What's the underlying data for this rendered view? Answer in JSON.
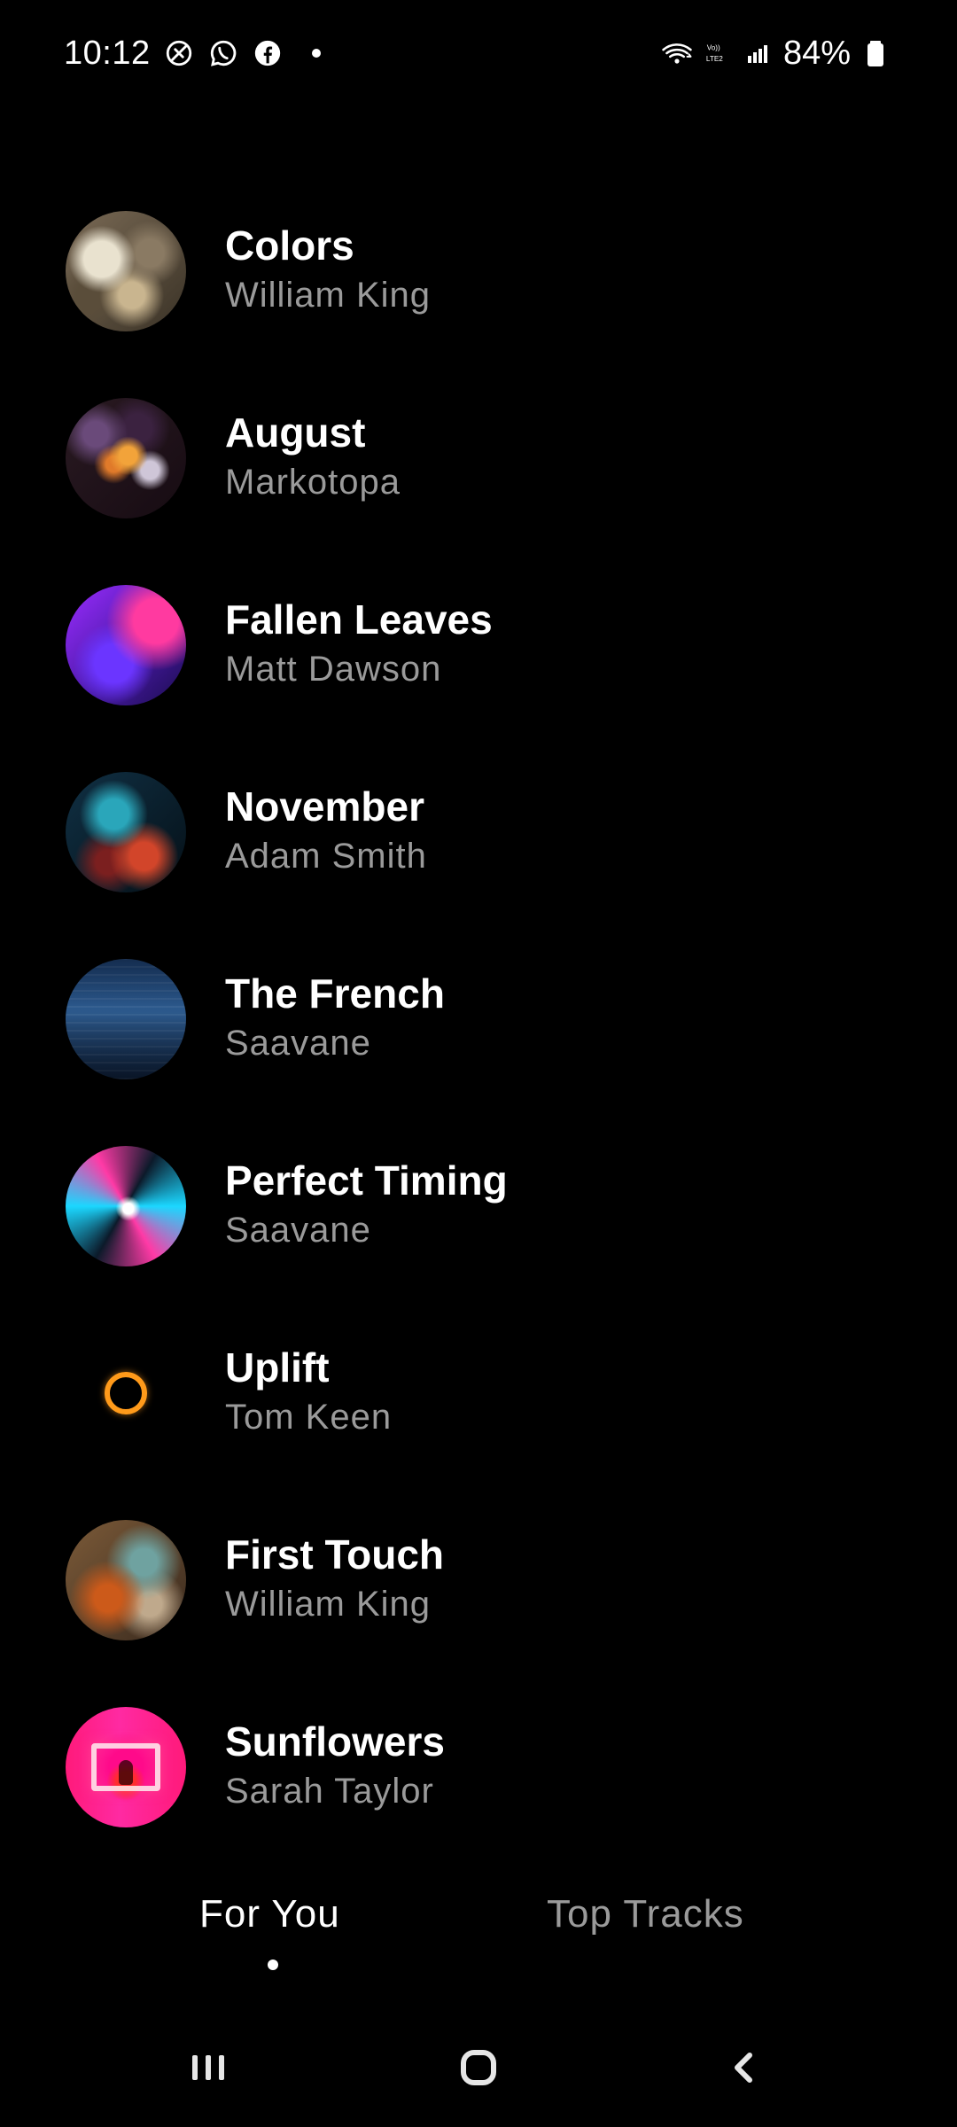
{
  "status_bar": {
    "time": "10:12",
    "battery": "84%",
    "left_icons": [
      "blocked-icon",
      "whatsapp-icon",
      "facebook-icon",
      "dot-icon"
    ],
    "right_icons": [
      "wifi-icon",
      "volte-lte2-icon",
      "signal-icon",
      "battery-icon"
    ]
  },
  "tracks": [
    {
      "title": "Colors",
      "artist": "William King"
    },
    {
      "title": "August",
      "artist": "Markotopa"
    },
    {
      "title": "Fallen Leaves",
      "artist": "Matt Dawson"
    },
    {
      "title": "November",
      "artist": "Adam Smith"
    },
    {
      "title": "The French",
      "artist": "Saavane"
    },
    {
      "title": "Perfect Timing",
      "artist": "Saavane"
    },
    {
      "title": "Uplift",
      "artist": "Tom Keen"
    },
    {
      "title": "First Touch",
      "artist": "William King"
    },
    {
      "title": "Sunflowers",
      "artist": "Sarah Taylor"
    }
  ],
  "tabs": [
    {
      "label": "For You",
      "active": true
    },
    {
      "label": "Top Tracks",
      "active": false
    }
  ],
  "system_nav": {
    "buttons": [
      "recents-icon",
      "home-icon",
      "back-icon"
    ]
  },
  "colors": {
    "background": "#000000",
    "title": "#ffffff",
    "subtitle": "#9a9a9a"
  }
}
